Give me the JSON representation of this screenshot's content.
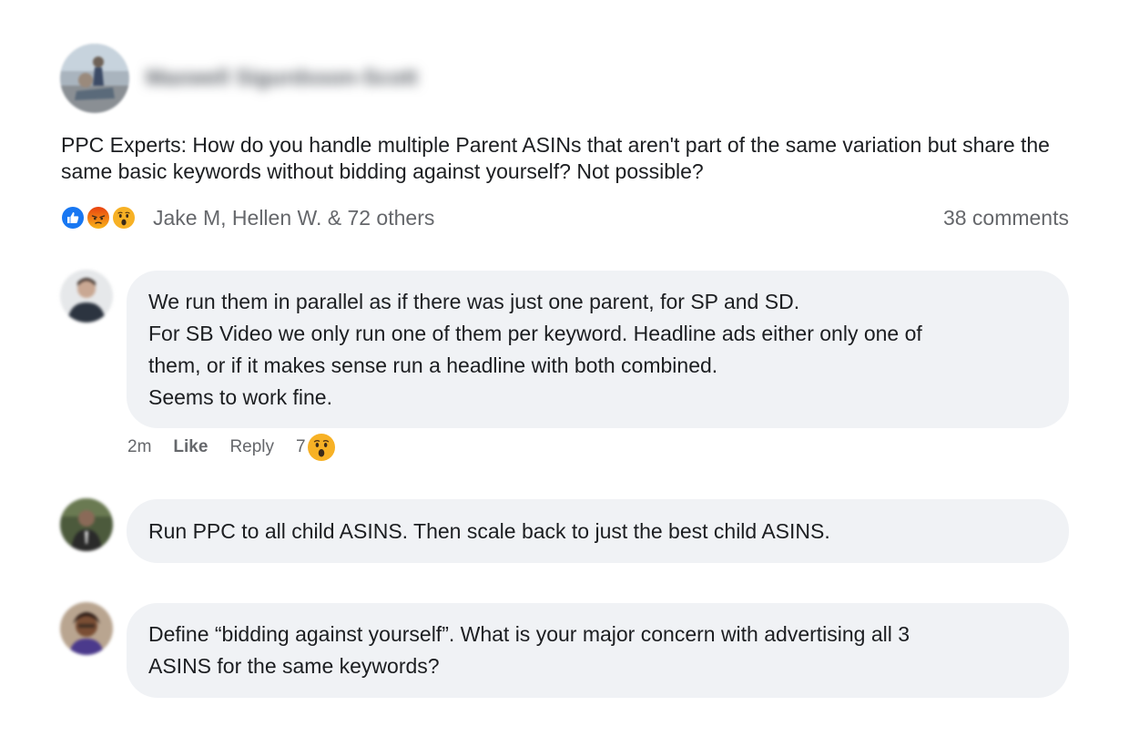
{
  "post": {
    "author_name": "Maxwell Sigurdsson-Scott",
    "text": "PPC Experts: How do you handle multiple Parent ASINs that aren't part of the same variation but share the same basic keywords without bidding against yourself? Not possible?",
    "reactions": {
      "icons": [
        "like-icon",
        "angry-icon",
        "wow-icon"
      ],
      "summary": "Jake M, Hellen W. & 72 others"
    },
    "comments_count": "38 comments"
  },
  "comments": [
    {
      "lines": [
        "We run them in parallel as if there was just one parent, for SP and SD.",
        "For SB Video we only run one of them per keyword. Headline ads either only one of",
        "them, or if it makes sense run a headline with both combined.",
        "Seems to work fine."
      ],
      "meta": {
        "time": "2m",
        "like_label": "Like",
        "reply_label": "Reply",
        "reaction_count": "7",
        "reaction_icon": "wow-icon"
      }
    },
    {
      "lines": [
        "Run PPC to all child ASINS. Then scale back to just the best child ASINS."
      ]
    },
    {
      "lines": [
        "Define “bidding against yourself”. What is your major concern with advertising all 3",
        "ASINS for the same keywords?"
      ]
    }
  ],
  "colors": {
    "like_blue": "#1877f2",
    "angry_orange": "#e9710f",
    "wow_yellow": "#f7b125",
    "bubble_bg": "#f0f2f5",
    "secondary_text": "#65676b"
  }
}
